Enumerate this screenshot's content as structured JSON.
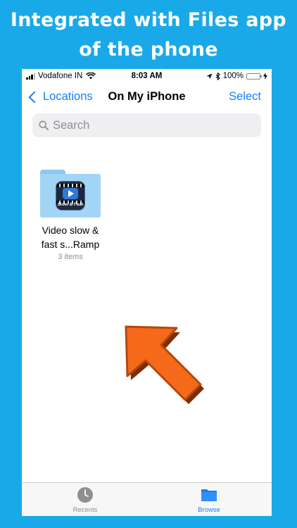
{
  "headline": {
    "line1": "Integrated with Files app",
    "line2": "of the phone"
  },
  "status_bar": {
    "carrier": "Vodafone IN",
    "time": "8:03 AM",
    "battery": "100%"
  },
  "nav": {
    "back_label": "Locations",
    "title": "On My iPhone",
    "select_label": "Select"
  },
  "search": {
    "placeholder": "Search",
    "value": ""
  },
  "files": [
    {
      "name_line1": "Video slow &",
      "name_line2": "fast s...Ramp",
      "count": "3 items",
      "icon": "slow-fast-app-icon",
      "icon_label": "Slow & Fast"
    }
  ],
  "tabbar": {
    "recents": "Recents",
    "browse": "Browse",
    "active": "browse"
  },
  "colors": {
    "background": "#19a9e8",
    "accent": "#147efb",
    "arrow": "#f56a1a",
    "folder": "#a2d4f5"
  }
}
